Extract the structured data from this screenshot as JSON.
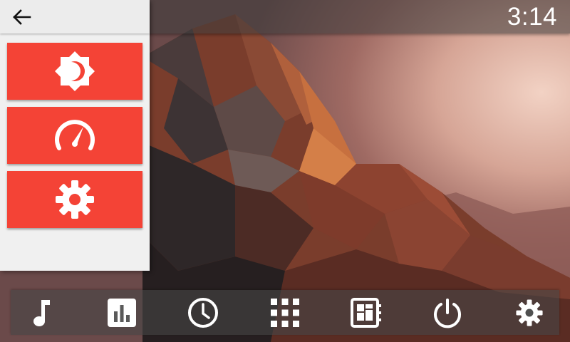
{
  "status_bar": {
    "clock": "3:14"
  },
  "side_panel": {
    "back_icon": "arrow-left-icon",
    "tiles": [
      {
        "name": "brightness",
        "icon": "brightness-icon"
      },
      {
        "name": "speedometer",
        "icon": "speedometer-icon"
      },
      {
        "name": "settings",
        "icon": "gear-icon"
      }
    ]
  },
  "dock": {
    "items": [
      {
        "name": "music",
        "icon": "music-note-icon"
      },
      {
        "name": "equalizer",
        "icon": "bar-chart-icon"
      },
      {
        "name": "clock",
        "icon": "clock-icon"
      },
      {
        "name": "apps",
        "icon": "app-grid-icon"
      },
      {
        "name": "dashboard",
        "icon": "dashboard-icon"
      },
      {
        "name": "power",
        "icon": "power-icon"
      },
      {
        "name": "settings",
        "icon": "gear-icon"
      }
    ]
  },
  "colors": {
    "accent": "#f44336",
    "panel_background": "#f0f0f0",
    "icon_light": "#ffffff"
  }
}
